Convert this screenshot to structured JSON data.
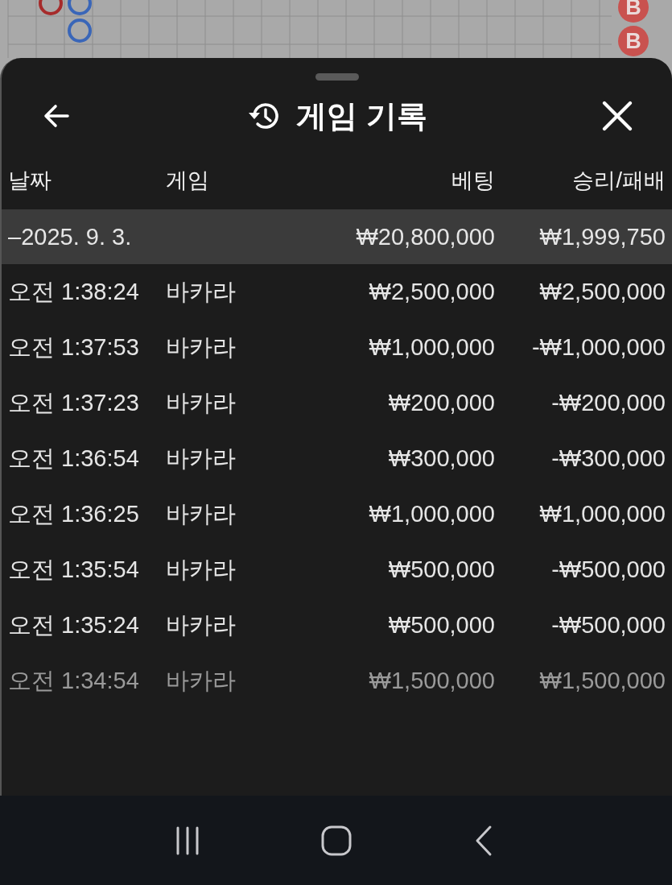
{
  "background_board": {
    "badges": [
      "B",
      "B"
    ]
  },
  "header": {
    "title": "게임 기록"
  },
  "table": {
    "columns": [
      "날짜",
      "게임",
      "베팅",
      "승리/패배"
    ],
    "group": {
      "date": "–2025. 9. 3.",
      "bet": "₩20,800,000",
      "result": "₩1,999,750"
    },
    "rows": [
      {
        "time": "오전 1:38:24",
        "game": "바카라",
        "bet": "₩2,500,000",
        "result": "₩2,500,000",
        "faded": false
      },
      {
        "time": "오전 1:37:53",
        "game": "바카라",
        "bet": "₩1,000,000",
        "result": "-₩1,000,000",
        "faded": false
      },
      {
        "time": "오전 1:37:23",
        "game": "바카라",
        "bet": "₩200,000",
        "result": "-₩200,000",
        "faded": false
      },
      {
        "time": "오전 1:36:54",
        "game": "바카라",
        "bet": "₩300,000",
        "result": "-₩300,000",
        "faded": false
      },
      {
        "time": "오전 1:36:25",
        "game": "바카라",
        "bet": "₩1,000,000",
        "result": "₩1,000,000",
        "faded": false
      },
      {
        "time": "오전 1:35:54",
        "game": "바카라",
        "bet": "₩500,000",
        "result": "-₩500,000",
        "faded": false
      },
      {
        "time": "오전 1:35:24",
        "game": "바카라",
        "bet": "₩500,000",
        "result": "-₩500,000",
        "faded": false
      },
      {
        "time": "오전 1:34:54",
        "game": "바카라",
        "bet": "₩1,500,000",
        "result": "₩1,500,000",
        "faded": true
      }
    ]
  }
}
